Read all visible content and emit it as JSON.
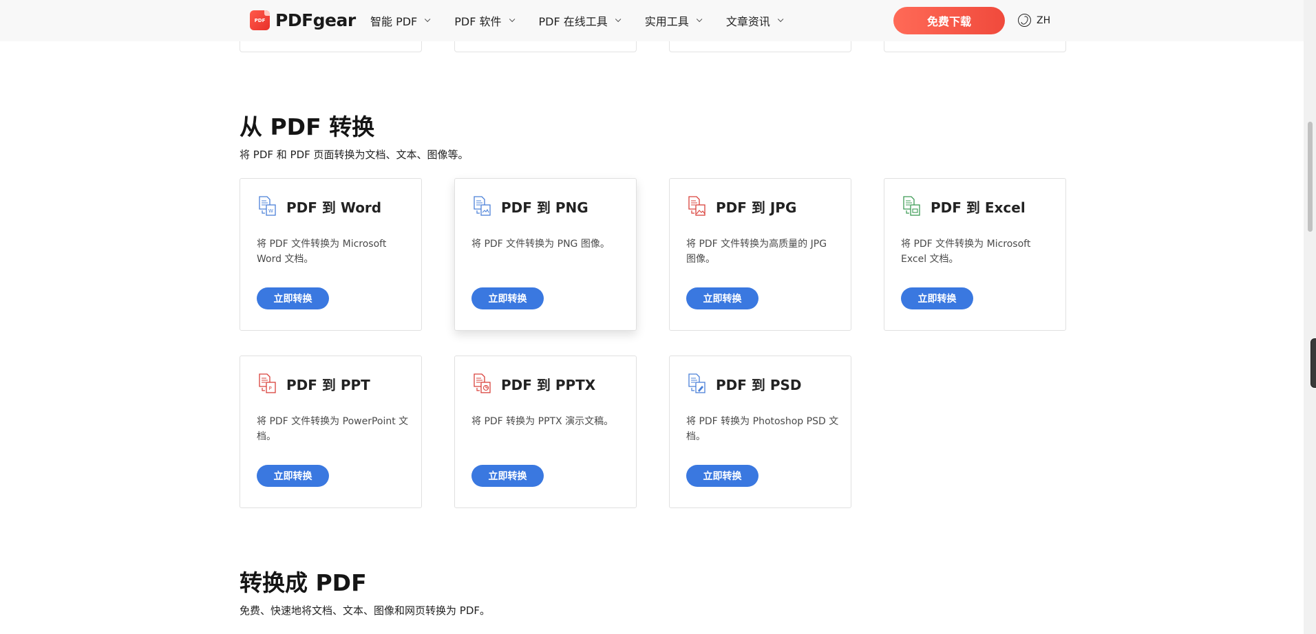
{
  "header": {
    "logo_mark": "PDF",
    "logo_text": "PDFgear",
    "nav": [
      "智能 PDF",
      "PDF 软件",
      "PDF 在线工具",
      "实用工具",
      "文章资讯"
    ],
    "download_label": "免费下载",
    "lang_label": "ZH"
  },
  "colors": {
    "accent_blue": "#3a78e0",
    "download_red": "#f04a3c",
    "icon_blue": "#4a80d8",
    "icon_red": "#d9403a",
    "icon_green": "#3c9b55"
  },
  "section_from_pdf": {
    "title": "从 PDF 转换",
    "subtitle": "将 PDF 和 PDF 页面转换为文档、文本、图像等。",
    "cards": [
      {
        "title": "PDF 到 Word",
        "desc": "将 PDF 文件转换为 Microsoft Word 文档。",
        "button": "立即转换",
        "icon": "pdf-to-word-icon"
      },
      {
        "title": "PDF 到 PNG",
        "desc": "将 PDF 文件转换为 PNG 图像。",
        "button": "立即转换",
        "icon": "pdf-to-png-icon"
      },
      {
        "title": "PDF 到 JPG",
        "desc": "将 PDF 文件转换为高质量的 JPG 图像。",
        "button": "立即转换",
        "icon": "pdf-to-jpg-icon"
      },
      {
        "title": "PDF 到 Excel",
        "desc": "将 PDF 文件转换为 Microsoft Excel 文档。",
        "button": "立即转换",
        "icon": "pdf-to-excel-icon"
      },
      {
        "title": "PDF 到 PPT",
        "desc": "将 PDF 文件转换为 PowerPoint 文档。",
        "button": "立即转换",
        "icon": "pdf-to-ppt-icon"
      },
      {
        "title": "PDF 到 PPTX",
        "desc": "将 PDF 转换为 PPTX 演示文稿。",
        "button": "立即转换",
        "icon": "pdf-to-pptx-icon"
      },
      {
        "title": "PDF 到 PSD",
        "desc": "将 PDF 转换为 Photoshop PSD 文档。",
        "button": "立即转换",
        "icon": "pdf-to-psd-icon"
      }
    ]
  },
  "section_to_pdf": {
    "title": "转换成 PDF",
    "subtitle": "免费、快速地将文档、文本、图像和网页转换为 PDF。"
  }
}
